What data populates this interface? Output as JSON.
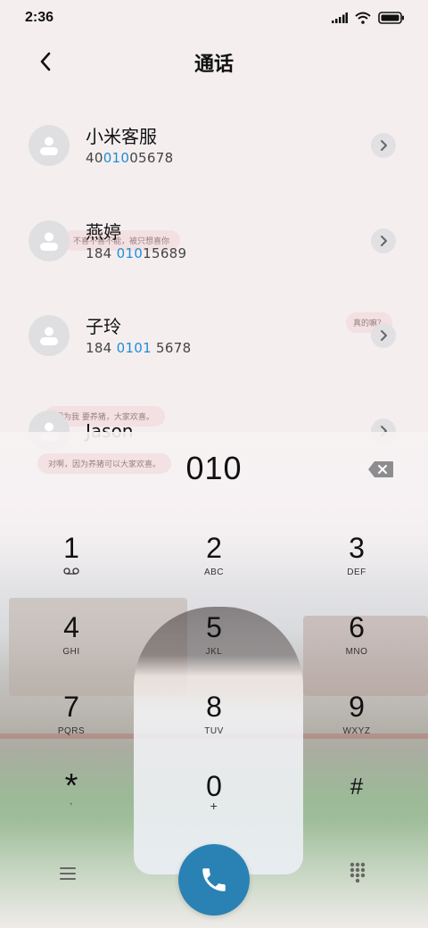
{
  "status_bar": {
    "time": "2:36"
  },
  "header": {
    "title": "通话"
  },
  "contacts": [
    {
      "name": "小米客服",
      "num_pre": "40",
      "num_hl": "010",
      "num_post": "05678"
    },
    {
      "name": "燕婷",
      "num_pre": "184 ",
      "num_hl": "010",
      "num_post": "15689"
    },
    {
      "name": "子玲",
      "num_pre": "184 ",
      "num_hl": "0101",
      "num_post": " 5678"
    },
    {
      "name": "Jason",
      "num_pre": "",
      "num_hl": "",
      "num_post": ""
    }
  ],
  "bubbles": {
    "b1": "不喜不喜不能，被只想喜你",
    "b2": "真的嘛？",
    "b3": "因为我 要养猪，大家欢喜。",
    "b4": "对啊，因为养猪可以大家欢喜。"
  },
  "dialer": {
    "number": "010",
    "keys": [
      {
        "digit": "1",
        "letters": ""
      },
      {
        "digit": "2",
        "letters": "ABC"
      },
      {
        "digit": "3",
        "letters": "DEF"
      },
      {
        "digit": "4",
        "letters": "GHI"
      },
      {
        "digit": "5",
        "letters": "JKL"
      },
      {
        "digit": "6",
        "letters": "MNO"
      },
      {
        "digit": "7",
        "letters": "PQRS"
      },
      {
        "digit": "8",
        "letters": "TUV"
      },
      {
        "digit": "9",
        "letters": "WXYZ"
      },
      {
        "digit": "*",
        "letters": ","
      },
      {
        "digit": "0",
        "letters": "+"
      },
      {
        "digit": "#",
        "letters": ""
      }
    ]
  },
  "colors": {
    "accent": "#1e8fd6",
    "call_button": "#2a82b4"
  },
  "icons": {
    "back": "chevron-left-icon",
    "voicemail": "voicemail-icon",
    "delete": "backspace-icon",
    "menu": "hamburger-menu-icon",
    "call": "phone-icon",
    "dialpad": "dialpad-icon"
  }
}
